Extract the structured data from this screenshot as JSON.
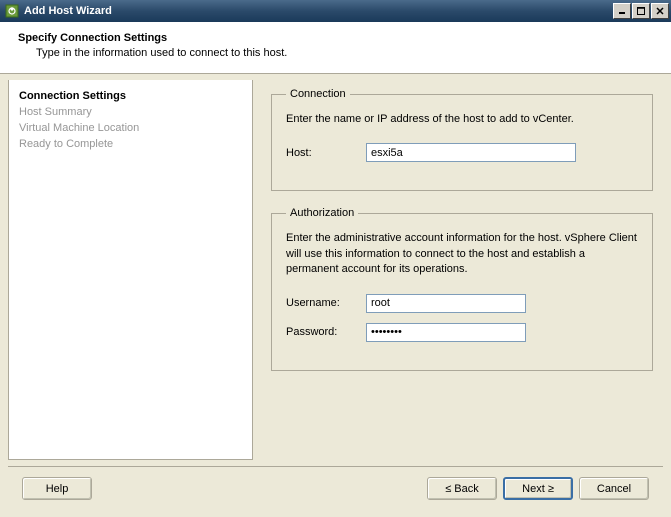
{
  "window": {
    "title": "Add Host Wizard"
  },
  "header": {
    "title": "Specify Connection Settings",
    "subtitle": "Type in the information used to connect to this host."
  },
  "sidebar": {
    "steps": [
      {
        "label": "Connection Settings",
        "active": true
      },
      {
        "label": "Host Summary",
        "active": false
      },
      {
        "label": "Virtual Machine Location",
        "active": false
      },
      {
        "label": "Ready to Complete",
        "active": false
      }
    ]
  },
  "connection": {
    "legend": "Connection",
    "instruction": "Enter the name or IP address of the host to add to vCenter.",
    "host_label": "Host:",
    "host_value": "esxi5a"
  },
  "authorization": {
    "legend": "Authorization",
    "instruction": "Enter the administrative account information for the host. vSphere Client will use this information to connect to the host and establish a permanent account for its operations.",
    "username_label": "Username:",
    "username_value": "root",
    "password_label": "Password:",
    "password_value": "********"
  },
  "footer": {
    "help": "Help",
    "back": "≤ Back",
    "next": "Next ≥",
    "cancel": "Cancel"
  }
}
